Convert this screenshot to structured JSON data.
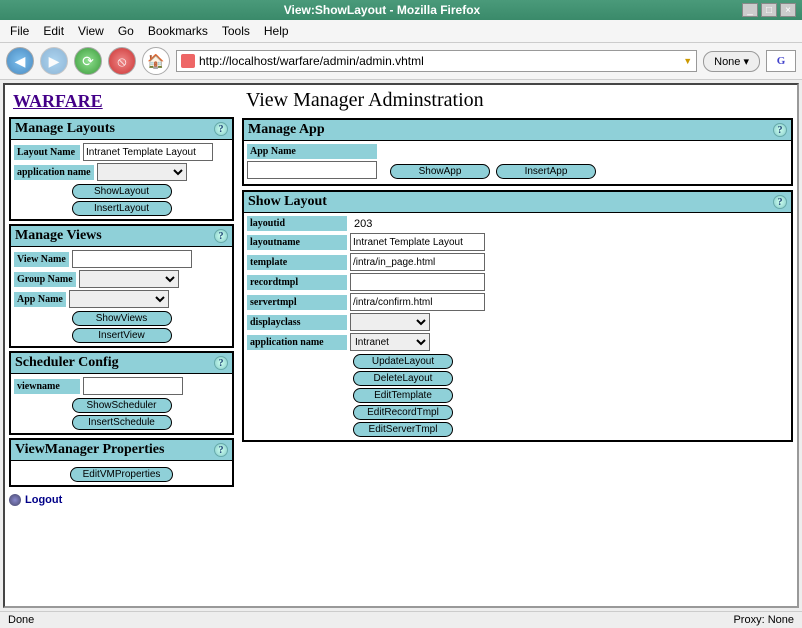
{
  "window": {
    "title": "View:ShowLayout - Mozilla Firefox"
  },
  "menubar": {
    "file": "File",
    "edit": "Edit",
    "view": "View",
    "go": "Go",
    "bookmarks": "Bookmarks",
    "tools": "Tools",
    "help": "Help"
  },
  "toolbar": {
    "url": "http://localhost/warfare/admin/admin.vhtml",
    "none": "None",
    "search": "G"
  },
  "page": {
    "site": "WARFARE",
    "title": "View Manager Adminstration",
    "logout": "Logout"
  },
  "panels": {
    "manageLayouts": {
      "title": "Manage Layouts",
      "layoutName_label": "Layout Name",
      "layoutName_value": "Intranet Template Layout",
      "appName_label": "application name",
      "buttons": {
        "show": "ShowLayout",
        "insert": "InsertLayout"
      }
    },
    "manageViews": {
      "title": "Manage Views",
      "view_label": "View Name",
      "group_label": "Group Name",
      "app_label": "App Name",
      "buttons": {
        "show": "ShowViews",
        "insert": "InsertView"
      }
    },
    "scheduler": {
      "title": "Scheduler Config",
      "viewname_label": "viewname",
      "buttons": {
        "show": "ShowScheduler",
        "insert": "InsertSchedule"
      }
    },
    "vmprops": {
      "title": "ViewManager Properties",
      "button": "EditVMProperties"
    },
    "manageApp": {
      "title": "Manage App",
      "appName_label": "App Name",
      "buttons": {
        "show": "ShowApp",
        "insert": "InsertApp"
      }
    },
    "showLayout": {
      "title": "Show Layout",
      "layoutid_label": "layoutid",
      "layoutid_value": "203",
      "layoutname_label": "layoutname",
      "layoutname_value": "Intranet Template Layout",
      "template_label": "template",
      "template_value": "/intra/in_page.html",
      "recordtmpl_label": "recordtmpl",
      "recordtmpl_value": "",
      "servertmpl_label": "servertmpl",
      "servertmpl_value": "/intra/confirm.html",
      "displayclass_label": "displayclass",
      "appname_label": "application name",
      "appname_value": "Intranet",
      "buttons": {
        "update": "UpdateLayout",
        "delete": "DeleteLayout",
        "editTemplate": "EditTemplate",
        "editRecord": "EditRecordTmpl",
        "editServer": "EditServerTmpl"
      }
    }
  },
  "status": {
    "left": "Done",
    "right": "Proxy: None"
  }
}
